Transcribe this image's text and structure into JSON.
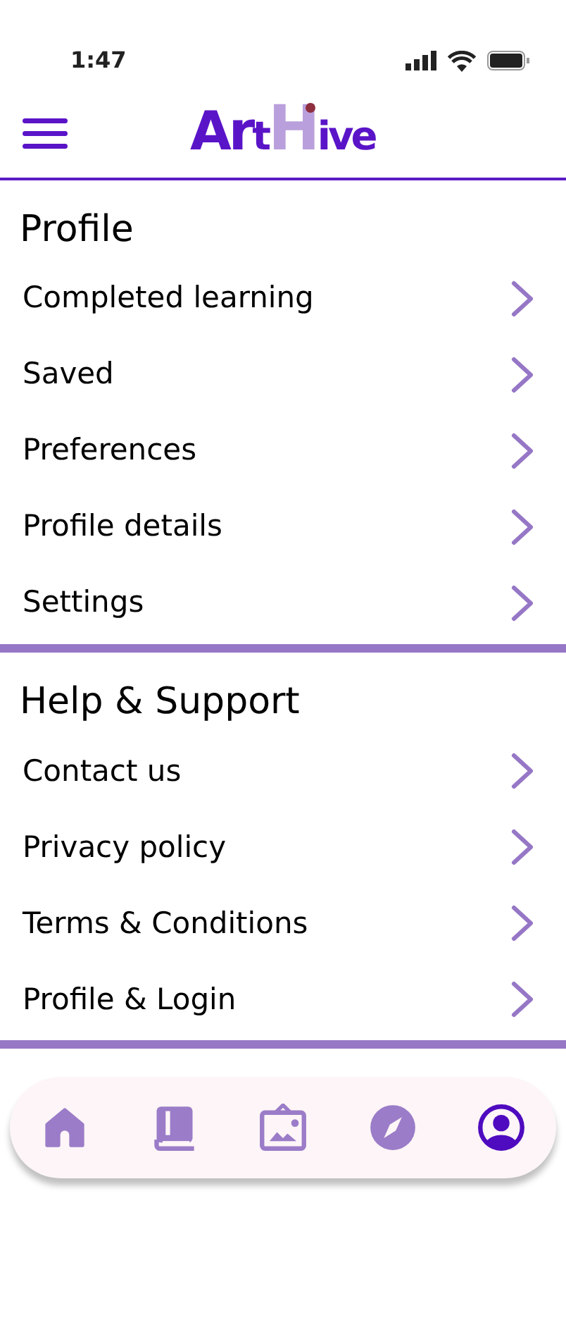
{
  "status_bar": {
    "time": "1:47"
  },
  "header": {
    "logo": [
      {
        "text": "Ar",
        "kind": "dark"
      },
      {
        "text": "t",
        "kind": "dark"
      },
      {
        "text": "H",
        "kind": "light"
      },
      {
        "text": "ive",
        "kind": "dark"
      }
    ]
  },
  "sections": [
    {
      "title": "Profile",
      "items": [
        {
          "label": "Completed learning"
        },
        {
          "label": "Saved"
        },
        {
          "label": "Preferences"
        },
        {
          "label": "Profile details"
        },
        {
          "label": "Settings"
        }
      ]
    },
    {
      "title": "Help & Support",
      "items": [
        {
          "label": "Contact us"
        },
        {
          "label": "Privacy policy"
        },
        {
          "label": "Terms & Conditions"
        },
        {
          "label": "Profile & Login"
        }
      ]
    }
  ],
  "bottom_nav": [
    {
      "kind": "home",
      "selected": false
    },
    {
      "kind": "book",
      "selected": false
    },
    {
      "kind": "gallery",
      "selected": false
    },
    {
      "kind": "compass",
      "selected": false
    },
    {
      "kind": "profile",
      "selected": true
    }
  ]
}
